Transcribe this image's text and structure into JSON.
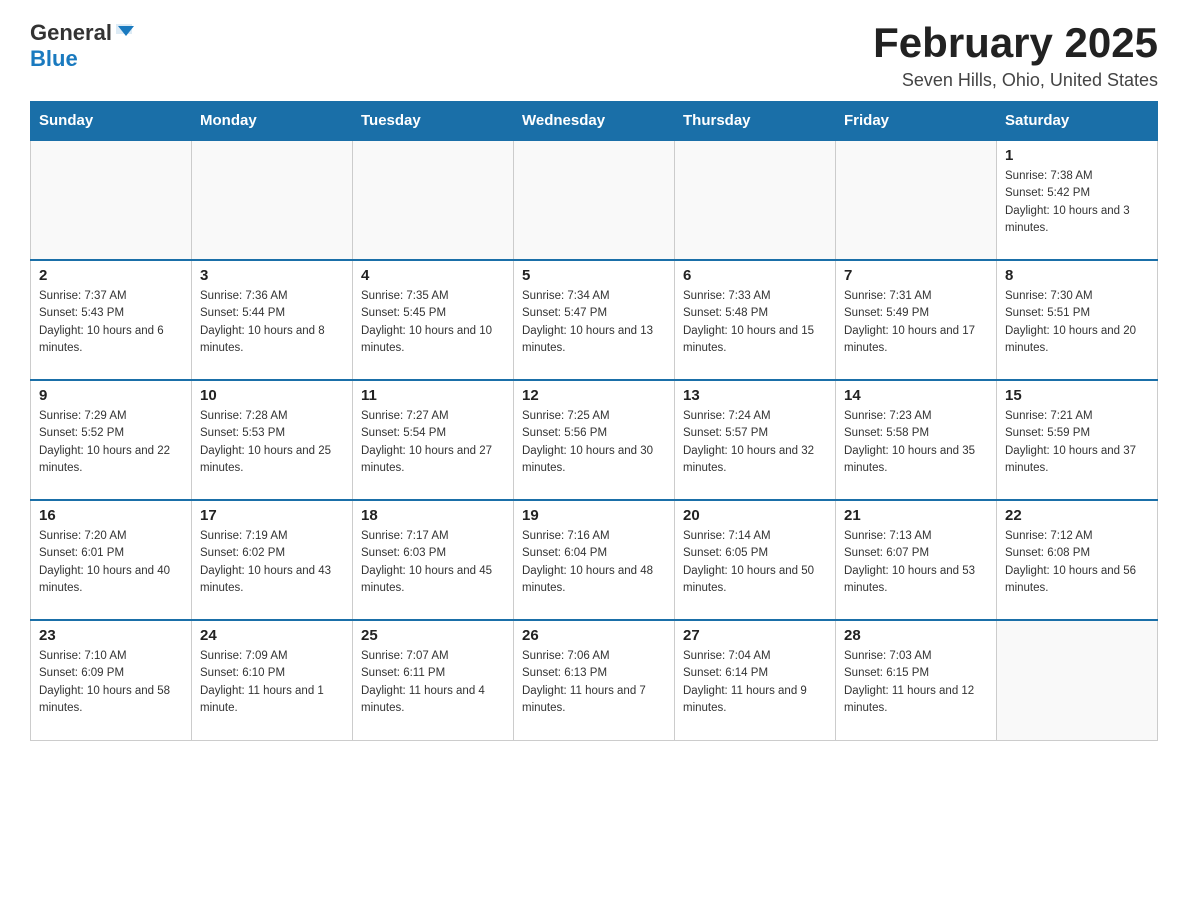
{
  "logo": {
    "text_general": "General",
    "text_blue": "Blue",
    "arrow_color": "#1a7abf"
  },
  "header": {
    "month_title": "February 2025",
    "location": "Seven Hills, Ohio, United States"
  },
  "weekdays": [
    "Sunday",
    "Monday",
    "Tuesday",
    "Wednesday",
    "Thursday",
    "Friday",
    "Saturday"
  ],
  "weeks": [
    [
      {
        "day": "",
        "info": ""
      },
      {
        "day": "",
        "info": ""
      },
      {
        "day": "",
        "info": ""
      },
      {
        "day": "",
        "info": ""
      },
      {
        "day": "",
        "info": ""
      },
      {
        "day": "",
        "info": ""
      },
      {
        "day": "1",
        "info": "Sunrise: 7:38 AM\nSunset: 5:42 PM\nDaylight: 10 hours and 3 minutes."
      }
    ],
    [
      {
        "day": "2",
        "info": "Sunrise: 7:37 AM\nSunset: 5:43 PM\nDaylight: 10 hours and 6 minutes."
      },
      {
        "day": "3",
        "info": "Sunrise: 7:36 AM\nSunset: 5:44 PM\nDaylight: 10 hours and 8 minutes."
      },
      {
        "day": "4",
        "info": "Sunrise: 7:35 AM\nSunset: 5:45 PM\nDaylight: 10 hours and 10 minutes."
      },
      {
        "day": "5",
        "info": "Sunrise: 7:34 AM\nSunset: 5:47 PM\nDaylight: 10 hours and 13 minutes."
      },
      {
        "day": "6",
        "info": "Sunrise: 7:33 AM\nSunset: 5:48 PM\nDaylight: 10 hours and 15 minutes."
      },
      {
        "day": "7",
        "info": "Sunrise: 7:31 AM\nSunset: 5:49 PM\nDaylight: 10 hours and 17 minutes."
      },
      {
        "day": "8",
        "info": "Sunrise: 7:30 AM\nSunset: 5:51 PM\nDaylight: 10 hours and 20 minutes."
      }
    ],
    [
      {
        "day": "9",
        "info": "Sunrise: 7:29 AM\nSunset: 5:52 PM\nDaylight: 10 hours and 22 minutes."
      },
      {
        "day": "10",
        "info": "Sunrise: 7:28 AM\nSunset: 5:53 PM\nDaylight: 10 hours and 25 minutes."
      },
      {
        "day": "11",
        "info": "Sunrise: 7:27 AM\nSunset: 5:54 PM\nDaylight: 10 hours and 27 minutes."
      },
      {
        "day": "12",
        "info": "Sunrise: 7:25 AM\nSunset: 5:56 PM\nDaylight: 10 hours and 30 minutes."
      },
      {
        "day": "13",
        "info": "Sunrise: 7:24 AM\nSunset: 5:57 PM\nDaylight: 10 hours and 32 minutes."
      },
      {
        "day": "14",
        "info": "Sunrise: 7:23 AM\nSunset: 5:58 PM\nDaylight: 10 hours and 35 minutes."
      },
      {
        "day": "15",
        "info": "Sunrise: 7:21 AM\nSunset: 5:59 PM\nDaylight: 10 hours and 37 minutes."
      }
    ],
    [
      {
        "day": "16",
        "info": "Sunrise: 7:20 AM\nSunset: 6:01 PM\nDaylight: 10 hours and 40 minutes."
      },
      {
        "day": "17",
        "info": "Sunrise: 7:19 AM\nSunset: 6:02 PM\nDaylight: 10 hours and 43 minutes."
      },
      {
        "day": "18",
        "info": "Sunrise: 7:17 AM\nSunset: 6:03 PM\nDaylight: 10 hours and 45 minutes."
      },
      {
        "day": "19",
        "info": "Sunrise: 7:16 AM\nSunset: 6:04 PM\nDaylight: 10 hours and 48 minutes."
      },
      {
        "day": "20",
        "info": "Sunrise: 7:14 AM\nSunset: 6:05 PM\nDaylight: 10 hours and 50 minutes."
      },
      {
        "day": "21",
        "info": "Sunrise: 7:13 AM\nSunset: 6:07 PM\nDaylight: 10 hours and 53 minutes."
      },
      {
        "day": "22",
        "info": "Sunrise: 7:12 AM\nSunset: 6:08 PM\nDaylight: 10 hours and 56 minutes."
      }
    ],
    [
      {
        "day": "23",
        "info": "Sunrise: 7:10 AM\nSunset: 6:09 PM\nDaylight: 10 hours and 58 minutes."
      },
      {
        "day": "24",
        "info": "Sunrise: 7:09 AM\nSunset: 6:10 PM\nDaylight: 11 hours and 1 minute."
      },
      {
        "day": "25",
        "info": "Sunrise: 7:07 AM\nSunset: 6:11 PM\nDaylight: 11 hours and 4 minutes."
      },
      {
        "day": "26",
        "info": "Sunrise: 7:06 AM\nSunset: 6:13 PM\nDaylight: 11 hours and 7 minutes."
      },
      {
        "day": "27",
        "info": "Sunrise: 7:04 AM\nSunset: 6:14 PM\nDaylight: 11 hours and 9 minutes."
      },
      {
        "day": "28",
        "info": "Sunrise: 7:03 AM\nSunset: 6:15 PM\nDaylight: 11 hours and 12 minutes."
      },
      {
        "day": "",
        "info": ""
      }
    ]
  ]
}
